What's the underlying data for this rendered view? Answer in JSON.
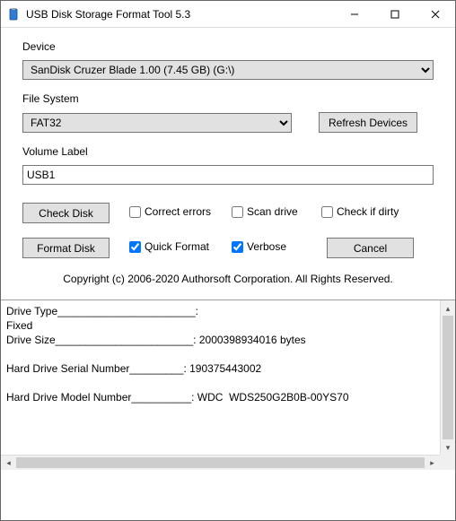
{
  "window": {
    "title": "USB Disk Storage Format Tool 5.3"
  },
  "labels": {
    "device": "Device",
    "file_system": "File System",
    "volume_label": "Volume Label"
  },
  "device": {
    "selected": "SanDisk  Cruzer Blade  1.00 (7.45 GB) (G:\\)"
  },
  "file_system": {
    "selected": "FAT32"
  },
  "buttons": {
    "refresh": "Refresh Devices",
    "check_disk": "Check Disk",
    "format_disk": "Format Disk",
    "cancel": "Cancel"
  },
  "volume": {
    "value": "USB1"
  },
  "checks": {
    "correct_errors": {
      "label": "Correct errors",
      "checked": false
    },
    "scan_drive": {
      "label": "Scan drive",
      "checked": false
    },
    "check_if_dirty": {
      "label": "Check if dirty",
      "checked": false
    },
    "quick_format": {
      "label": "Quick Format",
      "checked": true
    },
    "verbose": {
      "label": "Verbose",
      "checked": true
    }
  },
  "copyright": "Copyright (c) 2006-2020 Authorsoft Corporation. All Rights Reserved.",
  "info": {
    "line1": "Drive Type_______________________:",
    "line2": "Fixed",
    "line3": "Drive Size_______________________: 2000398934016 bytes",
    "blank1": "",
    "line4": "Hard Drive Serial Number_________: 190375443002",
    "blank2": "",
    "line5": "Hard Drive Model Number__________: WDC  WDS250G2B0B-00YS70"
  }
}
